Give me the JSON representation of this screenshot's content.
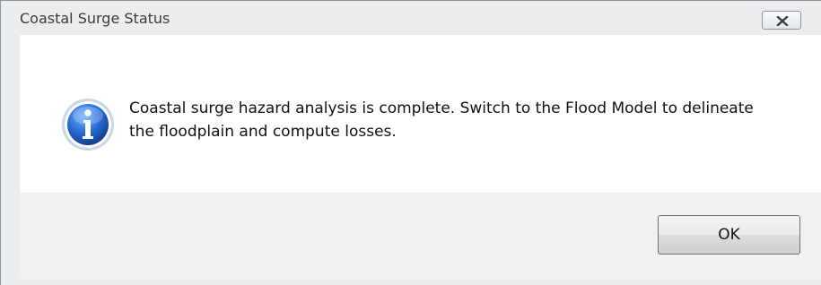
{
  "window": {
    "title": "Coastal Surge Status"
  },
  "message": {
    "text": "Coastal surge hazard analysis is complete. Switch to the Flood Model to delineate the floodplain and compute losses.",
    "icon": "information-icon"
  },
  "buttons": {
    "ok_label": "OK",
    "close_icon": "close-icon"
  },
  "colors": {
    "icon_blue": "#1b5fbf",
    "frame": "#ebedef",
    "footer": "#f0f0f0"
  }
}
